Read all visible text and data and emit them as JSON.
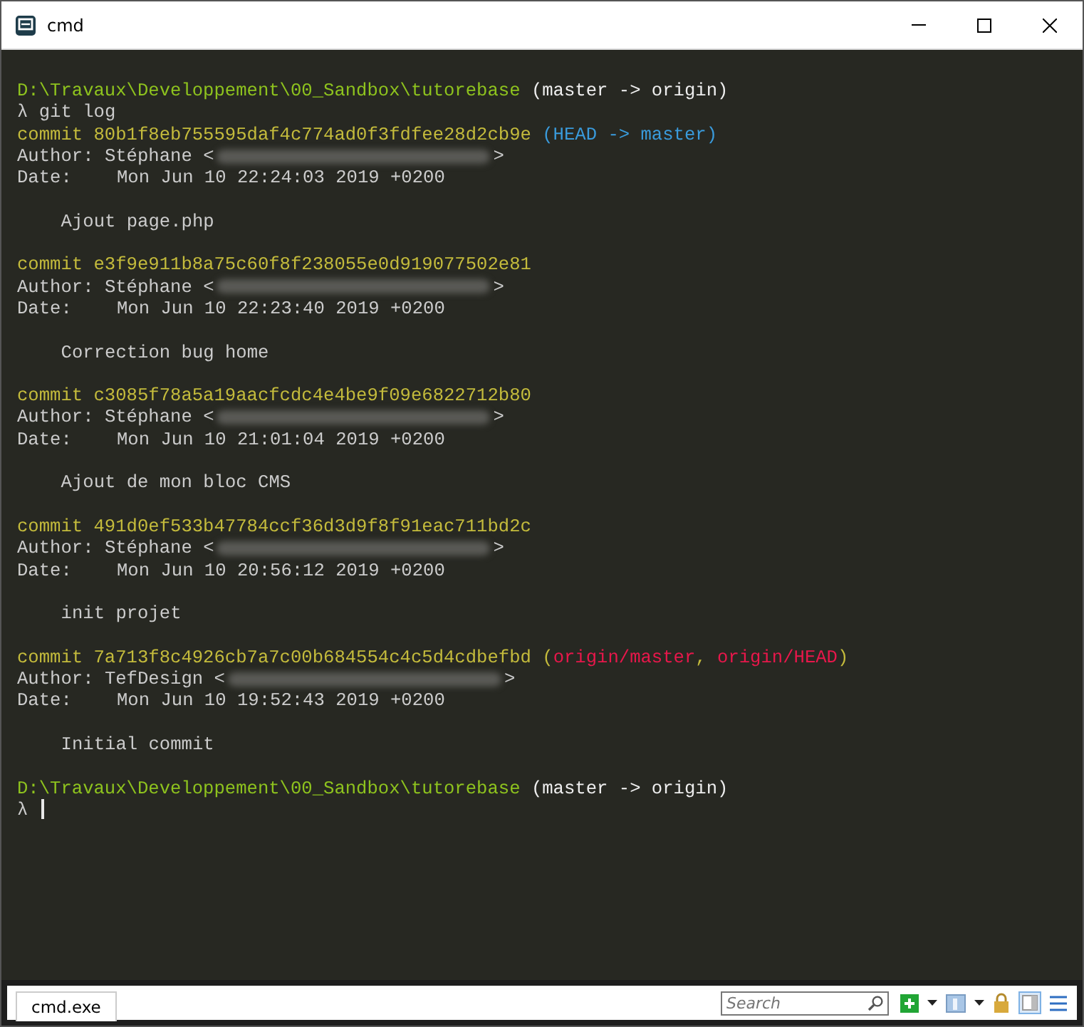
{
  "window": {
    "title": "cmd"
  },
  "terminal": {
    "lines": [
      {
        "kind": "prompt",
        "path": "D:\\Travaux\\Developpement\\00_Sandbox\\tutorebase",
        "branch": "(master -> origin)"
      },
      {
        "kind": "command",
        "symbol": "λ",
        "text": "git log",
        "cursor": false
      },
      {
        "kind": "commit",
        "text": "commit 80b1f8eb755595daf4c774ad0f3fdfee28d2cb9e",
        "refs": [
          {
            "text": "(HEAD -> master)",
            "color": "#3a9bdc"
          }
        ]
      },
      {
        "kind": "author",
        "label": "Author:",
        "name": "Stéphane <",
        "close": ">"
      },
      {
        "kind": "date",
        "label": "Date:",
        "value": "Mon Jun 10 22:24:03 2019 +0200"
      },
      {
        "kind": "blank"
      },
      {
        "kind": "message",
        "text": "Ajout page.php"
      },
      {
        "kind": "blank"
      },
      {
        "kind": "commit",
        "text": "commit e3f9e911b8a75c60f8f238055e0d919077502e81"
      },
      {
        "kind": "author",
        "label": "Author:",
        "name": "Stéphane <",
        "close": ">"
      },
      {
        "kind": "date",
        "label": "Date:",
        "value": "Mon Jun 10 22:23:40 2019 +0200"
      },
      {
        "kind": "blank"
      },
      {
        "kind": "message",
        "text": "Correction bug home"
      },
      {
        "kind": "blank"
      },
      {
        "kind": "commit",
        "text": "commit c3085f78a5a19aacfcdc4e4be9f09e6822712b80"
      },
      {
        "kind": "author",
        "label": "Author:",
        "name": "Stéphane <",
        "close": ">"
      },
      {
        "kind": "date",
        "label": "Date:",
        "value": "Mon Jun 10 21:01:04 2019 +0200"
      },
      {
        "kind": "blank"
      },
      {
        "kind": "message",
        "text": "Ajout de mon bloc CMS"
      },
      {
        "kind": "blank"
      },
      {
        "kind": "commit",
        "text": "commit 491d0ef533b47784ccf36d3d9f8f91eac711bd2c"
      },
      {
        "kind": "author",
        "label": "Author:",
        "name": "Stéphane <",
        "close": ">"
      },
      {
        "kind": "date",
        "label": "Date:",
        "value": "Mon Jun 10 20:56:12 2019 +0200"
      },
      {
        "kind": "blank"
      },
      {
        "kind": "message",
        "text": "init projet"
      },
      {
        "kind": "blank"
      },
      {
        "kind": "commit",
        "text": "commit 7a713f8c4926cb7a7c00b684554c4c5d4cdbefbd",
        "refs": [
          {
            "text": "(",
            "color": "#c4bb3c"
          },
          {
            "text": "origin/master",
            "color": "#e8174b"
          },
          {
            "text": ", ",
            "color": "#c4bb3c"
          },
          {
            "text": "origin/HEAD",
            "color": "#e8174b"
          },
          {
            "text": ")",
            "color": "#c4bb3c"
          }
        ]
      },
      {
        "kind": "author",
        "label": "Author:",
        "name": "TefDesign <",
        "close": ">"
      },
      {
        "kind": "date",
        "label": "Date:",
        "value": "Mon Jun 10 19:52:43 2019 +0200"
      },
      {
        "kind": "blank"
      },
      {
        "kind": "message",
        "text": "Initial commit"
      },
      {
        "kind": "blank"
      },
      {
        "kind": "prompt",
        "path": "D:\\Travaux\\Developpement\\00_Sandbox\\tutorebase",
        "branch": "(master -> origin)"
      },
      {
        "kind": "command",
        "symbol": "λ",
        "cursor": true
      }
    ]
  },
  "status_bar": {
    "tabs": [
      {
        "label": "cmd.exe",
        "selected": true
      }
    ],
    "search": {
      "placeholder": "Search"
    }
  }
}
